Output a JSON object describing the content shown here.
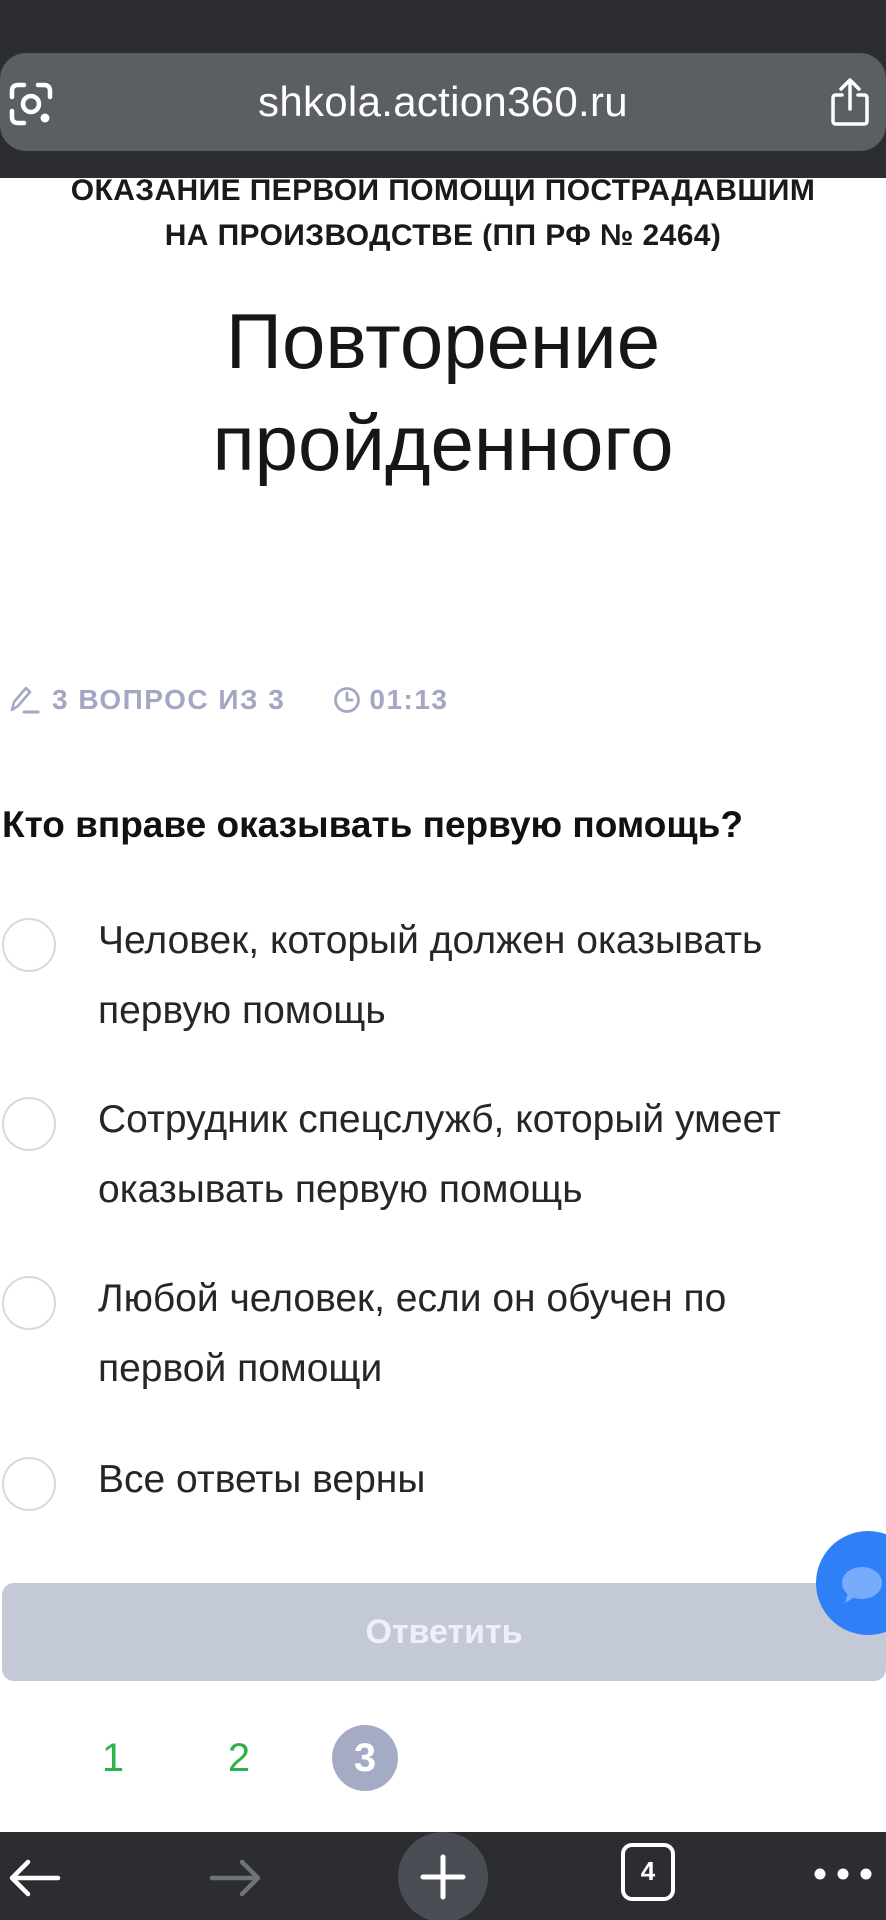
{
  "browser": {
    "url": "shkola.action360.ru",
    "tabs_count": "4"
  },
  "course": {
    "title_line1": "Оказание первой помощи пострадавшим",
    "title_line2": "на производстве (ПП РФ № 2464)"
  },
  "page": {
    "title_line1": "Повторение",
    "title_line2": "пройденного"
  },
  "quiz": {
    "progress_label": "3 вопрос из 3",
    "timer": "01:13",
    "question": "Кто вправе оказывать первую помощь?",
    "options": [
      {
        "line1": "Человек, который должен оказывать",
        "line2": "первую помощь"
      },
      {
        "line1": "Сотрудник спецслужб, который умеет",
        "line2": "оказывать первую помощь"
      },
      {
        "line1": "Любой человек, если он обучен по",
        "line2": "первой помощи"
      },
      {
        "line1": "Все ответы верны",
        "line2": ""
      }
    ],
    "answer_button": "Ответить",
    "pages": [
      "1",
      "2",
      "3"
    ]
  },
  "colors": {
    "accent_blue": "#2f80f7",
    "done_green": "#2bb24c",
    "muted": "#a3a7c3"
  },
  "icons": {
    "lens": "google-lens-icon",
    "share": "share-icon",
    "pen": "pen-icon",
    "clock": "clock-icon",
    "chat": "chat-bubble-icon",
    "back": "arrow-left-icon",
    "forward": "arrow-right-icon",
    "new_tab": "plus-icon",
    "tabs": "tabs-icon",
    "menu": "more-dots-icon"
  }
}
